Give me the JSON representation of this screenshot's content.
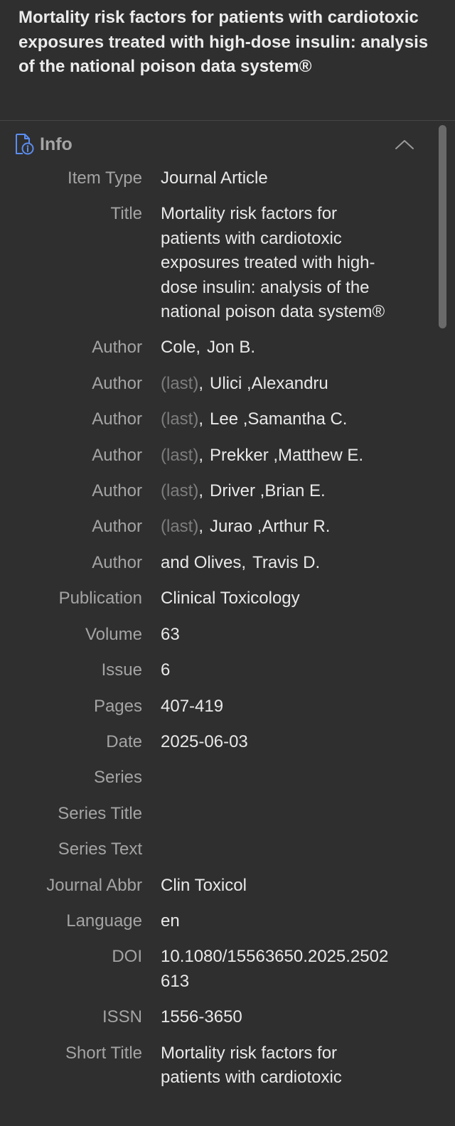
{
  "header": {
    "title": "Mortality risk factors for patients with cardiotoxic exposures treated with high-dose insulin: analysis of the national poison data system®"
  },
  "section": {
    "title": "Info",
    "icon": "document-info-icon",
    "collapse_icon": "chevron-up-icon"
  },
  "fields": {
    "item_type": {
      "label": "Item Type",
      "value": "Journal Article"
    },
    "title": {
      "label": "Title",
      "value": "Mortality risk factors for patients with cardiotoxic exposures treated with high-dose insulin: analysis of the national poison data system®"
    },
    "authors": [
      {
        "label": "Author",
        "last": "Cole",
        "comma": ",",
        "first": "Jon B.",
        "last_is_placeholder": false
      },
      {
        "label": "Author",
        "last": "(last)",
        "comma": ",",
        "first": "Ulici ,Alexandru",
        "last_is_placeholder": true
      },
      {
        "label": "Author",
        "last": "(last)",
        "comma": ",",
        "first": "Lee ,Samantha C.",
        "last_is_placeholder": true
      },
      {
        "label": "Author",
        "last": "(last)",
        "comma": ",",
        "first": "Prekker ,Matthew E.",
        "last_is_placeholder": true
      },
      {
        "label": "Author",
        "last": "(last)",
        "comma": ",",
        "first": "Driver ,Brian E.",
        "last_is_placeholder": true
      },
      {
        "label": "Author",
        "last": "(last)",
        "comma": ",",
        "first": "Jurao ,Arthur R.",
        "last_is_placeholder": true
      },
      {
        "label": "Author",
        "last": "and Olives",
        "comma": ",",
        "first": "Travis D.",
        "last_is_placeholder": false
      }
    ],
    "publication": {
      "label": "Publication",
      "value": "Clinical Toxicology"
    },
    "volume": {
      "label": "Volume",
      "value": "63"
    },
    "issue": {
      "label": "Issue",
      "value": "6"
    },
    "pages": {
      "label": "Pages",
      "value": "407-419"
    },
    "date": {
      "label": "Date",
      "value": "2025-06-03"
    },
    "series": {
      "label": "Series",
      "value": ""
    },
    "series_title": {
      "label": "Series Title",
      "value": ""
    },
    "series_text": {
      "label": "Series Text",
      "value": ""
    },
    "journal_abbr": {
      "label": "Journal Abbr",
      "value": "Clin Toxicol"
    },
    "language": {
      "label": "Language",
      "value": "en"
    },
    "doi": {
      "label": "DOI",
      "value": "10.1080/15563650.2025.2502613"
    },
    "issn": {
      "label": "ISSN",
      "value": "1556-3650"
    },
    "short_title": {
      "label": "Short Title",
      "value": "Mortality risk factors for patients with cardiotoxic"
    }
  },
  "colors": {
    "background": "#2f2f2f",
    "label": "#a4a4a4",
    "value": "#e9e9e9",
    "placeholder": "#7d7d7d",
    "icon_accent": "#5b8def"
  }
}
